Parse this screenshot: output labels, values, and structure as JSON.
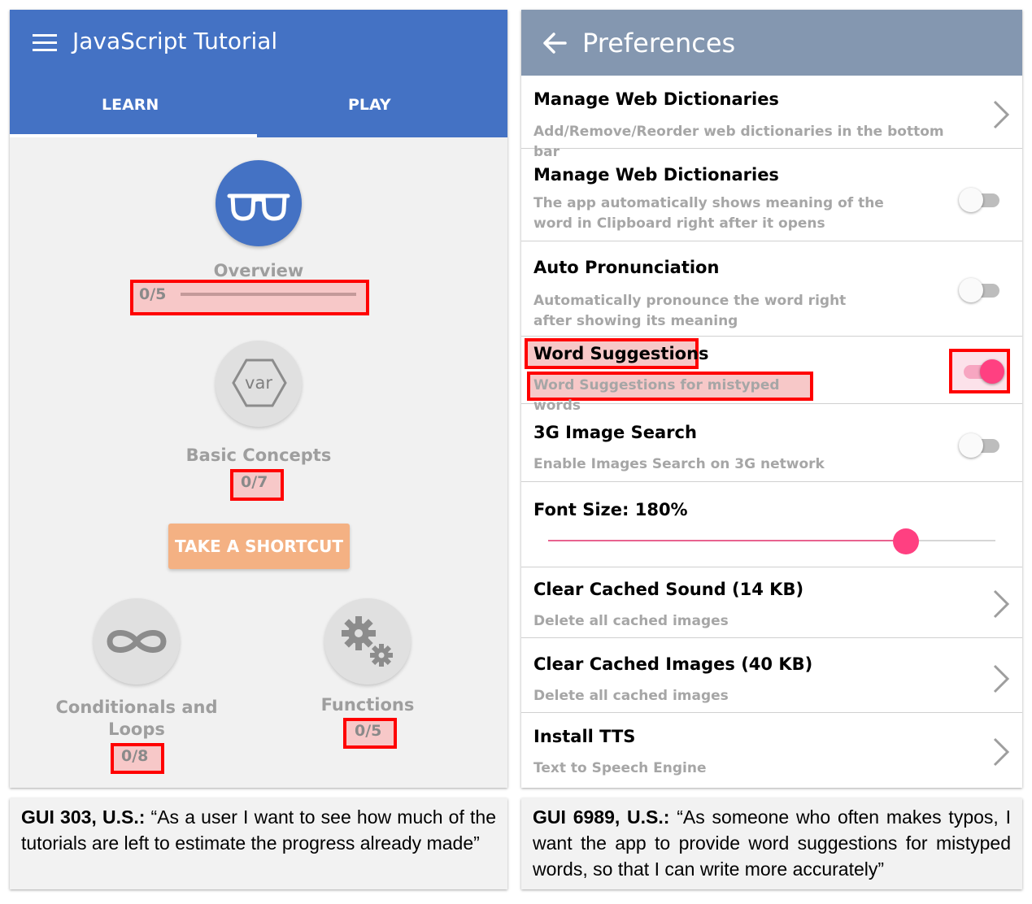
{
  "left": {
    "app_title": "JavaScript Tutorial",
    "tabs": [
      {
        "label": "LEARN",
        "active": true
      },
      {
        "label": "PLAY",
        "active": false
      }
    ],
    "lessons": {
      "overview": {
        "label": "Overview",
        "progress": "0/5",
        "progress_fraction": 0
      },
      "basic_concepts": {
        "label": "Basic Concepts",
        "progress": "0/7",
        "icon_text": "var"
      },
      "conditionals": {
        "label": "Conditionals and Loops",
        "progress": "0/8"
      },
      "functions": {
        "label": "Functions",
        "progress": "0/5"
      }
    },
    "shortcut_label": "TAKE A SHORTCUT",
    "icons": [
      "menu-icon",
      "glasses-icon",
      "hexagon-var-icon",
      "infinity-icon",
      "gears-icon"
    ],
    "colors": {
      "appbar": "#4472c4",
      "accent_button": "#f4b183",
      "overview_circle": "#4472c4"
    }
  },
  "right": {
    "title": "Preferences",
    "rows": [
      {
        "title": "Manage Web Dictionaries",
        "subtitle": "Add/Remove/Reorder web dictionaries in the bottom bar",
        "control": "chevron"
      },
      {
        "title": "Manage Web Dictionaries",
        "subtitle": "The app automatically shows meaning of the word in Clipboard right after it opens",
        "control": "toggle",
        "on": false
      },
      {
        "title": "Auto Pronunciation",
        "subtitle": "Automatically pronounce the word right after showing its meaning",
        "control": "toggle",
        "on": false
      },
      {
        "title": "Word Suggestions",
        "subtitle": "Word Suggestions for mistyped words",
        "control": "toggle",
        "on": true
      },
      {
        "title": "3G Image Search",
        "subtitle": "Enable Images Search on 3G network",
        "control": "toggle",
        "on": false
      },
      {
        "title": "Font Size: 180%",
        "control": "slider",
        "slider_fraction": 0.8
      },
      {
        "title": "Clear Cached Sound (14 KB)",
        "subtitle": "Delete all cached images",
        "control": "chevron"
      },
      {
        "title": "Clear Cached Images (40 KB)",
        "subtitle": "Delete all cached images",
        "control": "chevron"
      },
      {
        "title": "Install TTS",
        "subtitle": "Text to Speech Engine",
        "control": "chevron"
      }
    ],
    "icons": [
      "back-arrow-icon",
      "chevron-right-icon"
    ],
    "colors": {
      "appbar": "#8497b0",
      "toggle_on": "#ff4081",
      "slider": "#ff4081"
    }
  },
  "captions": {
    "left": {
      "label": "GUI 303, U.S.:",
      "text": " “As a user I want to see how much of the tutorials are left to estimate the progress already made”"
    },
    "right": {
      "label": "GUI 6989, U.S.:",
      "text": " “As someone who often makes typos, I want the app to provide word suggestions for mistyped words, so that I can write more accurately”"
    }
  },
  "highlight_color": "#ff0000"
}
